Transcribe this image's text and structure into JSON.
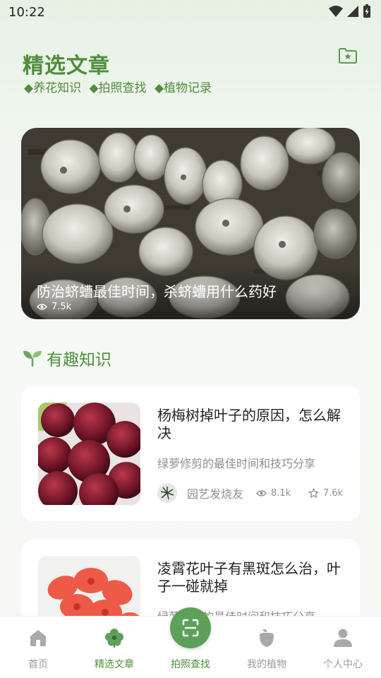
{
  "status_bar": {
    "time": "10:22"
  },
  "header": {
    "title": "精选文章",
    "tags": [
      "◆养花知识",
      "◆拍照查找",
      "◆植物记录"
    ],
    "folder_icon": "folder-star-icon"
  },
  "hero": {
    "title": "防治蛴螬最佳时间，杀蛴螬用什么药好",
    "views": "7.5k"
  },
  "section": {
    "title": "有趣知识"
  },
  "articles": [
    {
      "title": "杨梅树掉叶子的原因，怎么解决",
      "subtitle": "绿萝修剪的最佳时间和技巧分享",
      "author": "园艺发烧友",
      "views": "8.1k",
      "stars": "7.6k"
    },
    {
      "title": "凌霄花叶子有黑斑怎么治，叶子一碰就掉",
      "subtitle": "绿萝修剪的最佳时间和技巧分享"
    }
  ],
  "nav": {
    "items": [
      {
        "label": "首页",
        "icon": "home-icon"
      },
      {
        "label": "精选文章",
        "icon": "flower-icon"
      },
      {
        "label": "拍照查找",
        "icon": "scan-icon"
      },
      {
        "label": "我的植物",
        "icon": "plant-icon"
      },
      {
        "label": "个人中心",
        "icon": "user-icon"
      }
    ],
    "active_index": 1
  },
  "colors": {
    "accent": "#4f8d3b",
    "scan_button": "#5ea05a"
  }
}
